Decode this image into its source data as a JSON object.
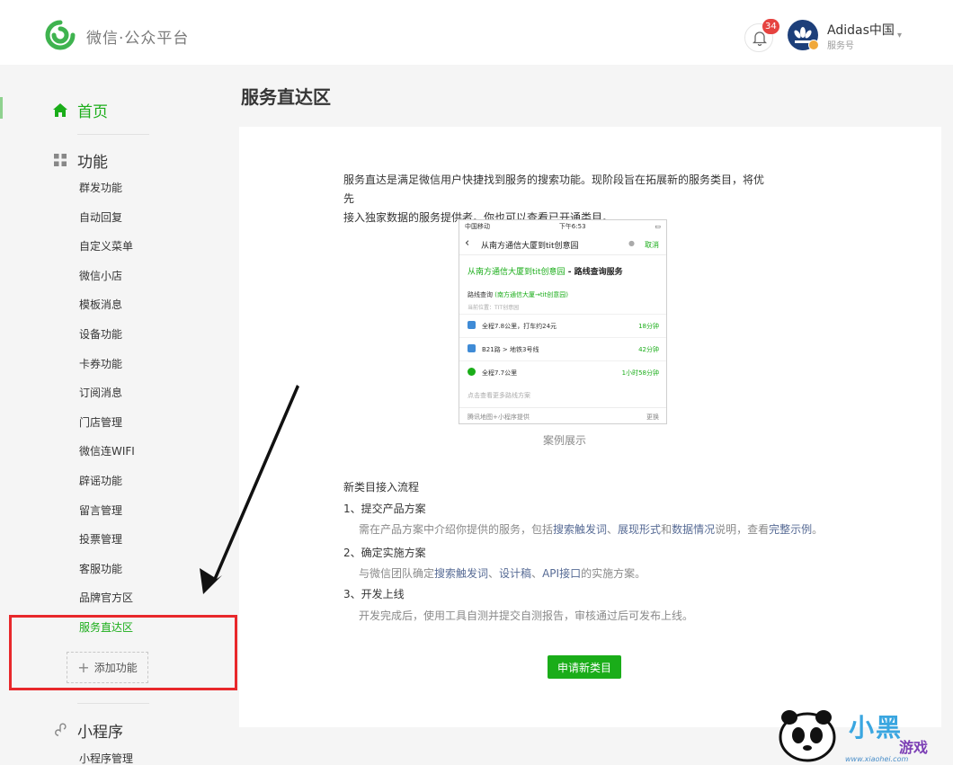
{
  "header": {
    "brand": "微信·公众平台",
    "notification_count": "34",
    "account_name": "Adidas中国",
    "account_type": "服务号"
  },
  "sidebar": {
    "home": "首页",
    "features_heading": "功能",
    "items": [
      {
        "label": "群发功能"
      },
      {
        "label": "自动回复"
      },
      {
        "label": "自定义菜单"
      },
      {
        "label": "微信小店"
      },
      {
        "label": "模板消息"
      },
      {
        "label": "设备功能"
      },
      {
        "label": "卡券功能"
      },
      {
        "label": "订阅消息"
      },
      {
        "label": "门店管理"
      },
      {
        "label": "微信连WIFI"
      },
      {
        "label": "辟谣功能"
      },
      {
        "label": "留言管理"
      },
      {
        "label": "投票管理"
      },
      {
        "label": "客服功能"
      },
      {
        "label": "品牌官方区"
      },
      {
        "label": "服务直达区",
        "active": true
      }
    ],
    "add_feature": "添加功能",
    "miniprogram_heading": "小程序",
    "miniprogram_manage": "小程序管理"
  },
  "main": {
    "title": "服务直达区",
    "intro_line1": "服务直达是满足微信用户快捷找到服务的搜索功能。现阶段旨在拓展新的服务类目，将优先",
    "intro_line2": "接入独家数据的服务提供者。你也可以查看已开通类目。",
    "case_caption": "案例展示",
    "flow_title": "新类目接入流程",
    "steps": [
      {
        "heading": "1、提交产品方案",
        "desc_a": "需在产品方案中介绍你提供的服务，包括",
        "link_1": "搜索触发词",
        "desc_b": "、",
        "link_2": "展现形式",
        "desc_c": "和",
        "link_3": "数据情况",
        "desc_d": "说明，查看",
        "link_4": "完整示例",
        "desc_e": "。"
      },
      {
        "heading": "2、确定实施方案",
        "desc_a": "与微信团队确定",
        "link_1": "搜索触发词",
        "desc_b": "、",
        "link_2": "设计稿",
        "desc_c": "、",
        "link_3": "API接口",
        "desc_d": "的实施方案。"
      },
      {
        "heading": "3、开发上线",
        "desc_a": "开发完成后，使用工具自测并提交自测报告，审核通过后可发布上线。"
      }
    ],
    "apply_button": "申请新类目"
  },
  "phone": {
    "carrier": "中国移动",
    "time": "下午6:53",
    "query": "从南方通信大厦到tit创意园",
    "cancel": "取消",
    "result_title_a": "从南方通信大厦到tit创意园",
    "result_title_b": " - 路线查询服务",
    "route_label": "路线查询",
    "route_detail": "(南方通信大厦→tit创意园)",
    "location": "当前位置：TIT创意园",
    "rows": [
      {
        "text": "全程7.8公里，打车约24元",
        "time": "18分钟"
      },
      {
        "text": "B21路 > 地铁3号线",
        "time": "42分钟"
      },
      {
        "text": "全程7.7公里",
        "time": "1小时58分钟"
      }
    ],
    "more": "点击查看更多路线方案",
    "source": "腾讯地图+小程序提供",
    "change": "更换"
  },
  "watermark": {
    "brand": "小黑",
    "sub": "游戏",
    "url": "www.xiaohei.com"
  },
  "colors": {
    "accent": "#1aad19",
    "link": "#576b95",
    "badge": "#e64340",
    "highlight_box": "#e8282b"
  }
}
